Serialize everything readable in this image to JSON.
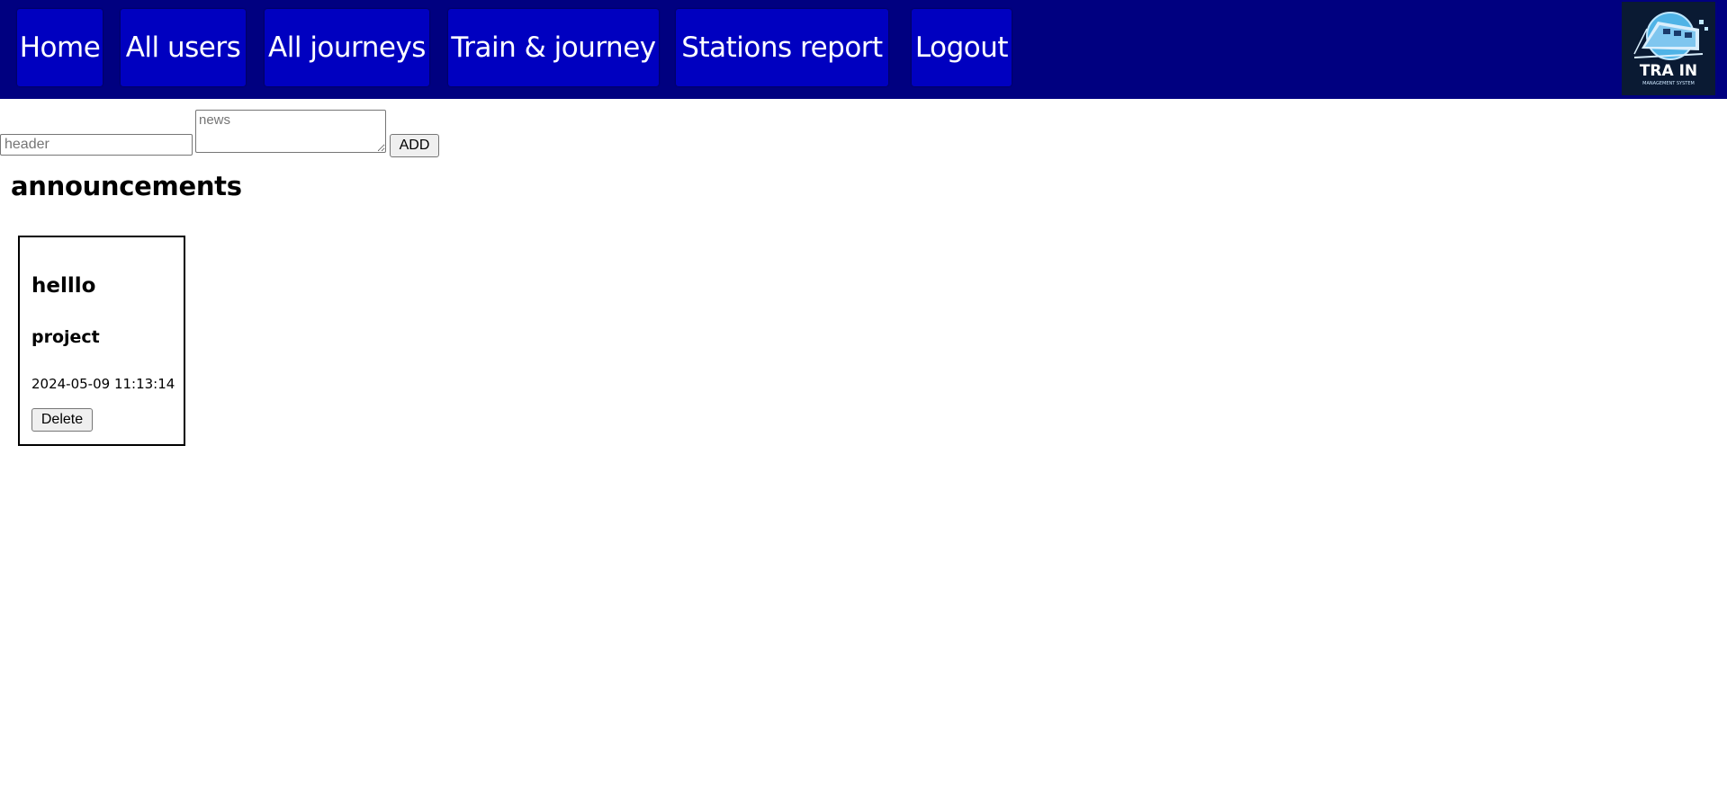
{
  "nav": {
    "items": [
      {
        "label": "Home"
      },
      {
        "label": "All users"
      },
      {
        "label": "All journeys"
      },
      {
        "label": "Train & journey"
      },
      {
        "label": "Stations report"
      },
      {
        "label": "Logout"
      }
    ]
  },
  "logo": {
    "text": "TRA IN",
    "subtext": "MANAGEMENT SYSTEM",
    "icon": "train-icon"
  },
  "form": {
    "header_placeholder": "header",
    "header_value": "",
    "news_placeholder": "news",
    "news_value": "",
    "add_label": "ADD"
  },
  "announcements": {
    "title": "announcements",
    "items": [
      {
        "title": "helllo",
        "body": "project",
        "date": "2024-05-09 11:13:14",
        "delete_label": "Delete"
      }
    ]
  },
  "colors": {
    "navbar": "#000080",
    "nav_button": "#0000c0",
    "logo_bg": "#0a1a33"
  }
}
